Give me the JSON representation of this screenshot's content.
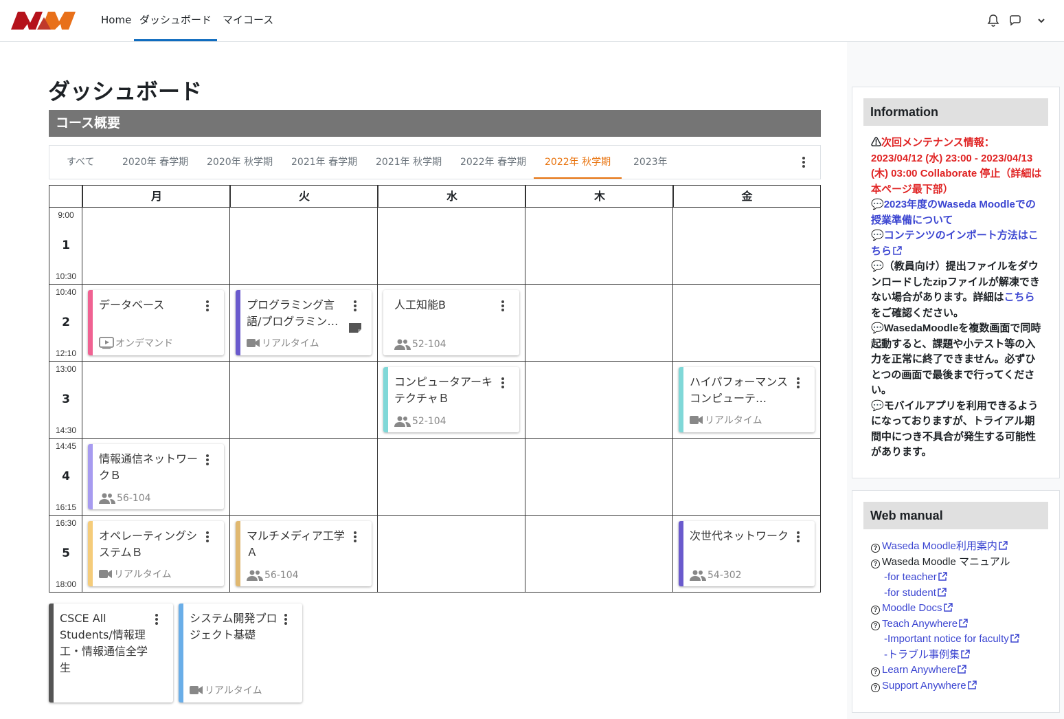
{
  "nav": {
    "home": "Home",
    "dashboard": "ダッシュボード",
    "mycourses": "マイコース"
  },
  "page_title": "ダッシュボード",
  "section_title": "コース概要",
  "tabs": [
    "すべて",
    "2020年 春学期",
    "2020年 秋学期",
    "2021年 春学期",
    "2021年 秋学期",
    "2022年 春学期",
    "2022年 秋学期",
    "2023年"
  ],
  "active_tab": "2022年 秋学期",
  "days": [
    "月",
    "火",
    "水",
    "木",
    "金"
  ],
  "periods": [
    {
      "num": "1",
      "start": "9:00",
      "end": "10:30"
    },
    {
      "num": "2",
      "start": "10:40",
      "end": "12:10"
    },
    {
      "num": "3",
      "start": "13:00",
      "end": "14:30"
    },
    {
      "num": "4",
      "start": "14:45",
      "end": "16:15"
    },
    {
      "num": "5",
      "start": "16:30",
      "end": "18:00"
    }
  ],
  "courses": [
    {
      "title": "データベース",
      "meta": "オンデマンド",
      "meta_icon": "video-play-icon",
      "color": "#f06292"
    },
    {
      "title": "プログラミング言語/プログラミン…",
      "meta": "リアルタイム",
      "meta_icon": "video-camera-icon",
      "color": "#6a5acd"
    },
    {
      "title": "人工知能B",
      "meta": "52-104",
      "meta_icon": "people-icon",
      "color": "#ffffff"
    },
    {
      "title": "コンピュータアーキテクチャＢ",
      "meta": "52-104",
      "meta_icon": "people-icon",
      "color": "#80d8d8"
    },
    {
      "title": "ハイパフォーマンスコンピューテ…",
      "meta": "リアルタイム",
      "meta_icon": "video-camera-icon",
      "color": "#80d8d8"
    },
    {
      "title": "情報通信ネットワークＢ",
      "meta": "56-104",
      "meta_icon": "people-icon",
      "color": "#a79bf0"
    },
    {
      "title": "オペレーティングシステムＢ",
      "meta": "リアルタイム",
      "meta_icon": "video-camera-icon",
      "color": "#f5cc7a"
    },
    {
      "title": "マルチメディア工学Ａ",
      "meta": "56-104",
      "meta_icon": "people-icon",
      "color": "#e0b870"
    },
    {
      "title": "次世代ネットワーク",
      "meta": "54-302",
      "meta_icon": "people-icon",
      "color": "#6a5acd"
    }
  ],
  "extra_courses": [
    {
      "title": "CSCE All Students/情報理工・情報通信全学生",
      "meta": "",
      "color": "#555555"
    },
    {
      "title": "システム開発プロジェクト基礎",
      "meta": "リアルタイム",
      "meta_icon": "video-camera-icon",
      "color": "#6aaee8"
    }
  ],
  "information": {
    "title": "Information",
    "maintenance": "次回メンテナンス情報：2023/04/12 (水) 23:00 - 2023/04/13 (木) 03:00 Collaborate 停止（詳細は本ページ最下部）",
    "link1": "2023年度のWaseda Moodleでの授業準備について",
    "link2": "コンテンツのインポート方法はこちら",
    "note1_pre": "（教員向け）提出ファイルをダウンロードしたzipファイルが解凍できない場合があります。詳細は",
    "note1_link": "こちら",
    "note1_post": "をご確認ください。",
    "note2": "WasedaMoodleを複数画面で同時起動すると、課題や小テスト等の入力を正常に終了できません。必ずひとつの画面で最後まで行ってください。",
    "note3": "モバイルアプリを利用できるようになっておりますが、トライアル期間中につき不具合が発生する可能性があります。"
  },
  "web_manual": {
    "title": "Web manual",
    "items": [
      {
        "label": "Waseda Moodle利用案内",
        "link": true,
        "indent": false,
        "q": true
      },
      {
        "label": "Waseda Moodle マニュアル",
        "link": false,
        "indent": false,
        "q": true
      },
      {
        "label": "-for teacher",
        "link": true,
        "indent": true,
        "q": false
      },
      {
        "label": "-for student",
        "link": true,
        "indent": true,
        "q": false
      },
      {
        "label": "Moodle Docs",
        "link": true,
        "indent": false,
        "q": true
      },
      {
        "label": "Teach Anywhere",
        "link": true,
        "indent": false,
        "q": true
      },
      {
        "label": "-Important notice for faculty",
        "link": true,
        "indent": true,
        "q": false
      },
      {
        "label": "-トラブル事例集",
        "link": true,
        "indent": true,
        "q": false
      },
      {
        "label": "Learn Anywhere",
        "link": true,
        "indent": false,
        "q": true
      },
      {
        "label": "Support Anywhere",
        "link": true,
        "indent": false,
        "q": true
      }
    ]
  }
}
